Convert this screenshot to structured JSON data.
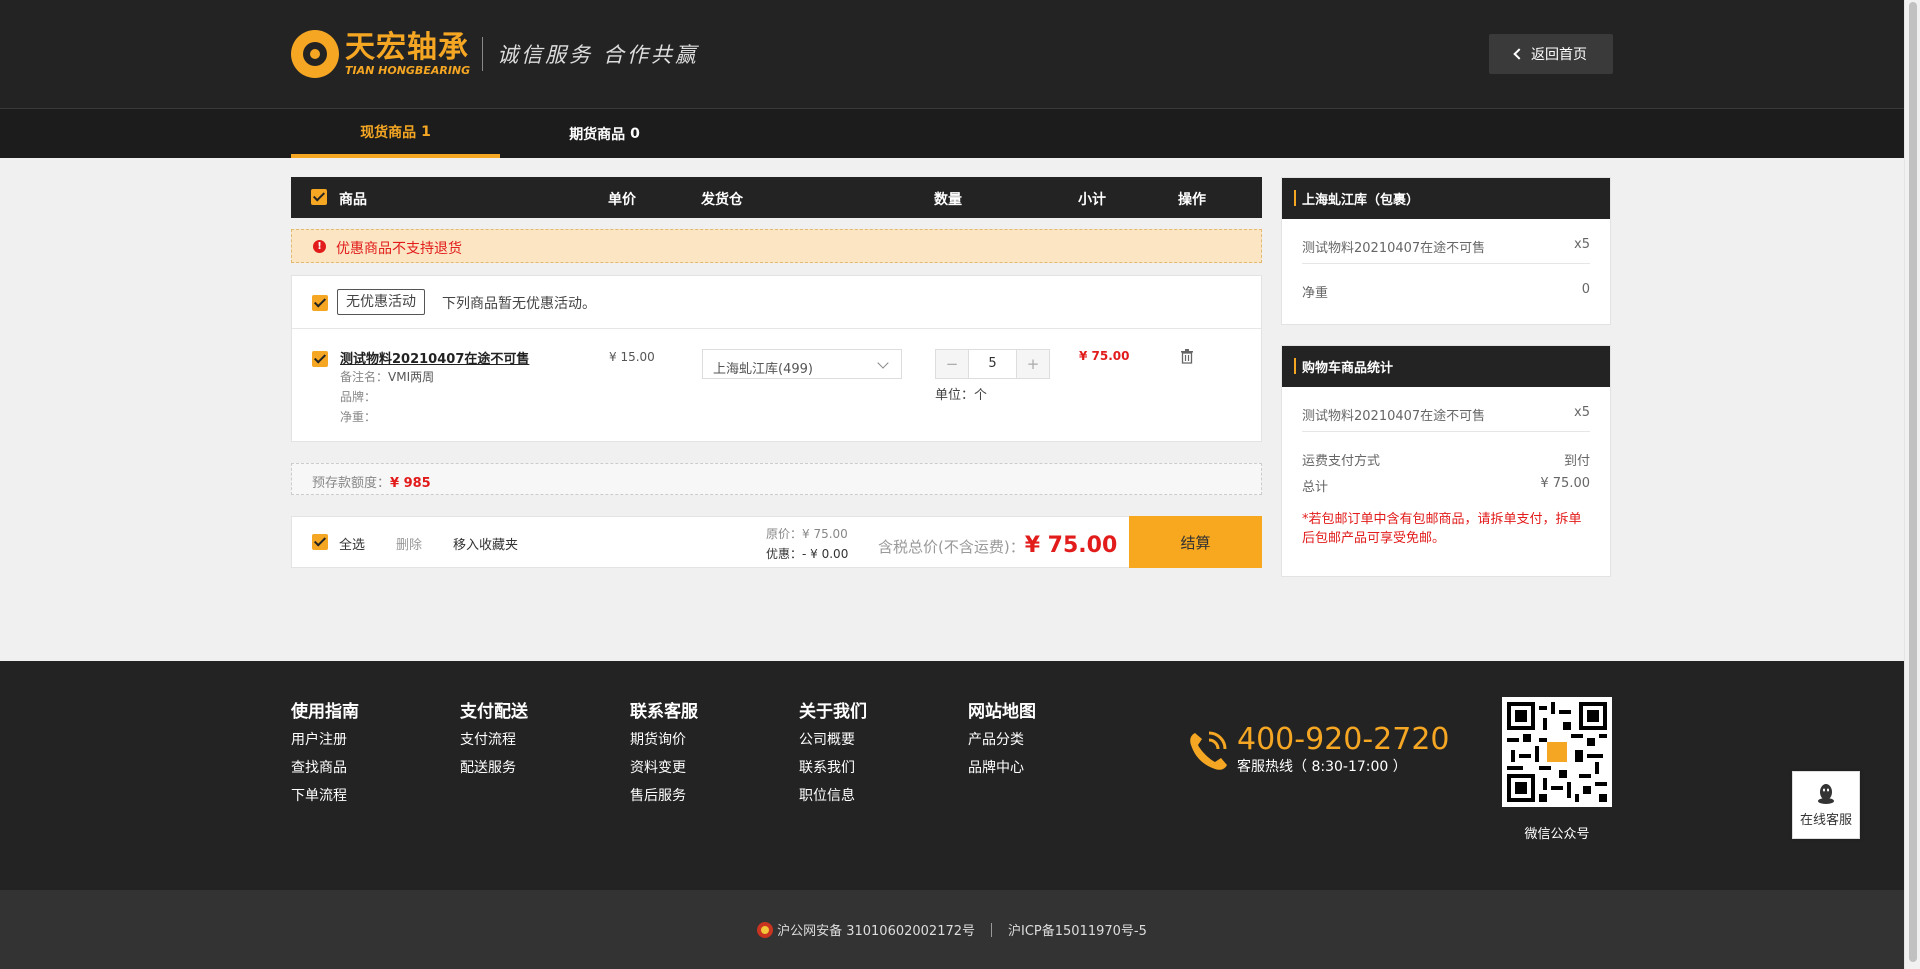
{
  "header": {
    "logo_cn": "天宏轴承",
    "logo_en": "TIAN HONGBEARING",
    "slogan": "诚信服务 合作共赢",
    "back_label": "返回首页"
  },
  "tabs": [
    {
      "label": "现货商品",
      "count": "1"
    },
    {
      "label": "期货商品",
      "count": "0"
    }
  ],
  "cart": {
    "columns": {
      "product": "商品",
      "price": "单价",
      "warehouse": "发货仓",
      "qty": "数量",
      "subtotal": "小计",
      "action": "操作"
    },
    "notice": "优惠商品不支持退货",
    "group": {
      "tag": "无优惠活动",
      "desc": "下列商品暂无优惠活动。"
    },
    "item": {
      "name": "测试物料20210407在途不可售",
      "note_label": "备注名：",
      "note_value": "VMI两周",
      "brand_label": "品牌：",
      "weight_label": "净重：",
      "price": "¥ 15.00",
      "warehouse": "上海虬江库(499)",
      "qty": "5",
      "unit_label": "单位：",
      "unit_value": "个",
      "subtotal": "¥ 75.00"
    },
    "deposit": {
      "label": "预存款额度：",
      "amount": "¥ 985"
    },
    "footer": {
      "select_all": "全选",
      "delete": "删除",
      "favorite": "移入收藏夹",
      "orig_label": "原价：",
      "orig_value": "¥ 75.00",
      "discount_label": "优惠：",
      "discount_value": "- ¥ 0.00",
      "total_label": "含税总价(不含运费)：",
      "total_value": "¥ 75.00",
      "checkout": "结算"
    }
  },
  "side1": {
    "title": "上海虬江库（包裹）",
    "item_name": "测试物料20210407在途不可售",
    "item_qty": "x5",
    "weight_label": "净重",
    "weight_value": "0"
  },
  "side2": {
    "title": "购物车商品统计",
    "item_name": "测试物料20210407在途不可售",
    "item_qty": "x5",
    "pay_label": "运费支付方式",
    "pay_value": "到付",
    "total_label": "总计",
    "total_value": "¥ 75.00",
    "note": "*若包邮订单中含有包邮商品，请拆单支付，拆单后包邮产品可享受免邮。"
  },
  "footer": {
    "cols": [
      {
        "title": "使用指南",
        "links": [
          "用户注册",
          "查找商品",
          "下单流程"
        ]
      },
      {
        "title": "支付配送",
        "links": [
          "支付流程",
          "配送服务"
        ]
      },
      {
        "title": "联系客服",
        "links": [
          "期货询价",
          "资料变更",
          "售后服务"
        ]
      },
      {
        "title": "关于我们",
        "links": [
          "公司概要",
          "联系我们",
          "职位信息"
        ]
      },
      {
        "title": "网站地图",
        "links": [
          "产品分类",
          "品牌中心"
        ]
      }
    ],
    "phone": "400-920-2720",
    "phone_sub": "客服热线（ 8:30-17:00 ）",
    "qr_caption": "微信公众号",
    "police": "沪公网安备 31010602002172号",
    "icp": "沪ICP备15011970号-5"
  },
  "online_service": "在线客服",
  "colors": {
    "accent": "#f5a623",
    "dark": "#232323",
    "danger": "#e21b1b"
  }
}
